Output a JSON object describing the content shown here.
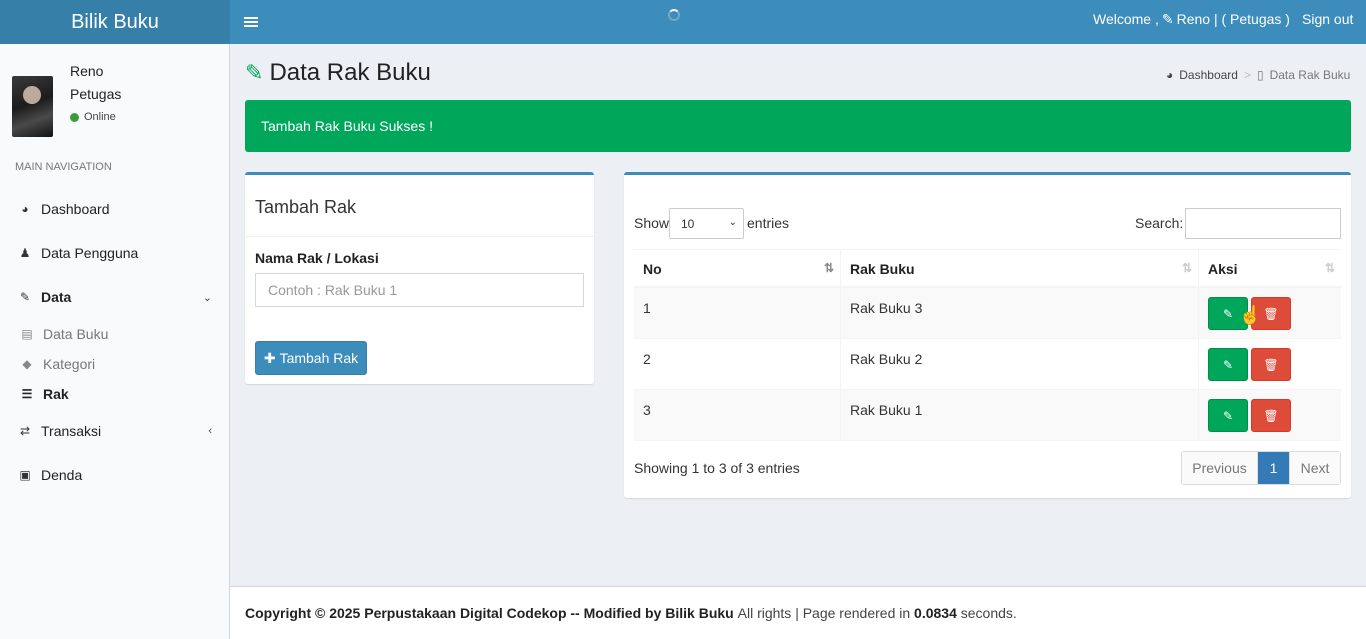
{
  "header": {
    "brand": "Bilik Buku",
    "welcome_prefix": "Welcome ,",
    "welcome_user": "Reno | ( Petugas )",
    "signout": "Sign out",
    "brand_color": "#3c8dbc"
  },
  "sidebar": {
    "user_name": "Reno",
    "user_role": "Petugas",
    "status": "Online",
    "nav_header": "MAIN NAVIGATION",
    "items": [
      {
        "label": "Dashboard",
        "icon": "dashboard-icon"
      },
      {
        "label": "Data Pengguna",
        "icon": "user-icon"
      },
      {
        "label": "Data",
        "icon": "edit-square-icon",
        "expanded": true
      },
      {
        "label": "Transaksi",
        "icon": "exchange-icon"
      },
      {
        "label": "Denda",
        "icon": "money-icon"
      }
    ],
    "sub_items": [
      {
        "label": "Data Buku",
        "icon": "book-icon"
      },
      {
        "label": "Kategori",
        "icon": "tags-icon"
      },
      {
        "label": "Rak",
        "icon": "list-icon",
        "active": true
      }
    ]
  },
  "page": {
    "title": "Data Rak Buku",
    "breadcrumb": [
      "Dashboard",
      "Data Rak Buku"
    ]
  },
  "alert": {
    "message": "Tambah Rak Buku Sukses !",
    "color": "#00a65a"
  },
  "form": {
    "title": "Tambah Rak",
    "label": "Nama Rak / Lokasi",
    "placeholder": "Contoh : Rak Buku 1",
    "value": "",
    "submit": "Tambah Rak"
  },
  "table": {
    "show_label": "Show",
    "page_size": "10",
    "entries_label": "entries",
    "search_label": "Search:",
    "search_value": "",
    "columns": [
      "No",
      "Rak Buku",
      "Aksi"
    ],
    "rows": [
      {
        "no": "1",
        "rak": "Rak Buku 3"
      },
      {
        "no": "2",
        "rak": "Rak Buku 2"
      },
      {
        "no": "3",
        "rak": "Rak Buku 1"
      }
    ],
    "info": "Showing 1 to 3 of 3 entries",
    "pagination": {
      "previous": "Previous",
      "current": "1",
      "next": "Next"
    }
  },
  "footer": {
    "copyright": "Copyright © 2025 Perpustakaan Digital Codekop -- Modified by Bilik Buku",
    "rights": "All rights | Page rendered in",
    "time": "0.0834",
    "suffix": "seconds."
  }
}
